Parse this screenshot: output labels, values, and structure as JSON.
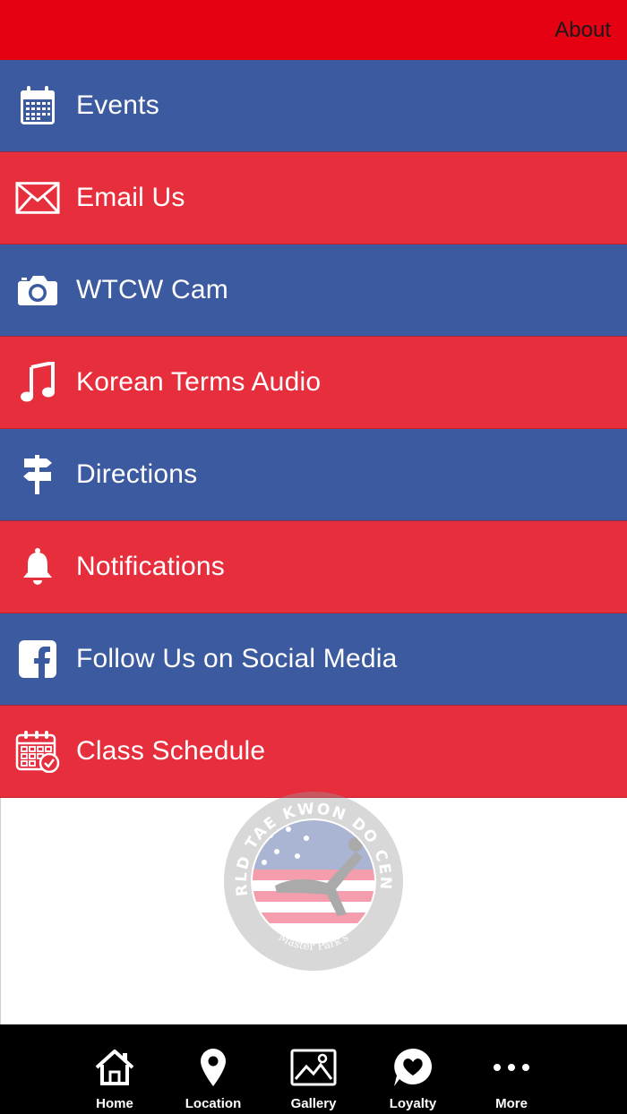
{
  "header": {
    "about_label": "About"
  },
  "menu": {
    "items": [
      {
        "label": "Events",
        "icon": "calendar-icon"
      },
      {
        "label": "Email Us",
        "icon": "envelope-icon"
      },
      {
        "label": "WTCW Cam",
        "icon": "camera-icon"
      },
      {
        "label": "Korean Terms Audio",
        "icon": "music-note-icon"
      },
      {
        "label": "Directions",
        "icon": "signpost-icon"
      },
      {
        "label": "Notifications",
        "icon": "bell-icon"
      },
      {
        "label": "Follow Us on Social Media",
        "icon": "facebook-icon"
      },
      {
        "label": "Class Schedule",
        "icon": "calendar-check-icon"
      }
    ]
  },
  "logo": {
    "arc_text": "WORLD TAE KWON DO CENTER",
    "bottom_text": "Master Park's"
  },
  "tabbar": {
    "tabs": [
      {
        "label": "Home",
        "icon": "home-icon"
      },
      {
        "label": "Location",
        "icon": "map-pin-icon"
      },
      {
        "label": "Gallery",
        "icon": "image-icon"
      },
      {
        "label": "Loyalty",
        "icon": "heart-bubble-icon"
      },
      {
        "label": "More",
        "icon": "more-dots-icon"
      }
    ]
  },
  "colors": {
    "header_red": "#e50012",
    "row_blue": "#3c5aa0",
    "row_red": "#e72e3d",
    "tabbar_bg": "#000000"
  }
}
